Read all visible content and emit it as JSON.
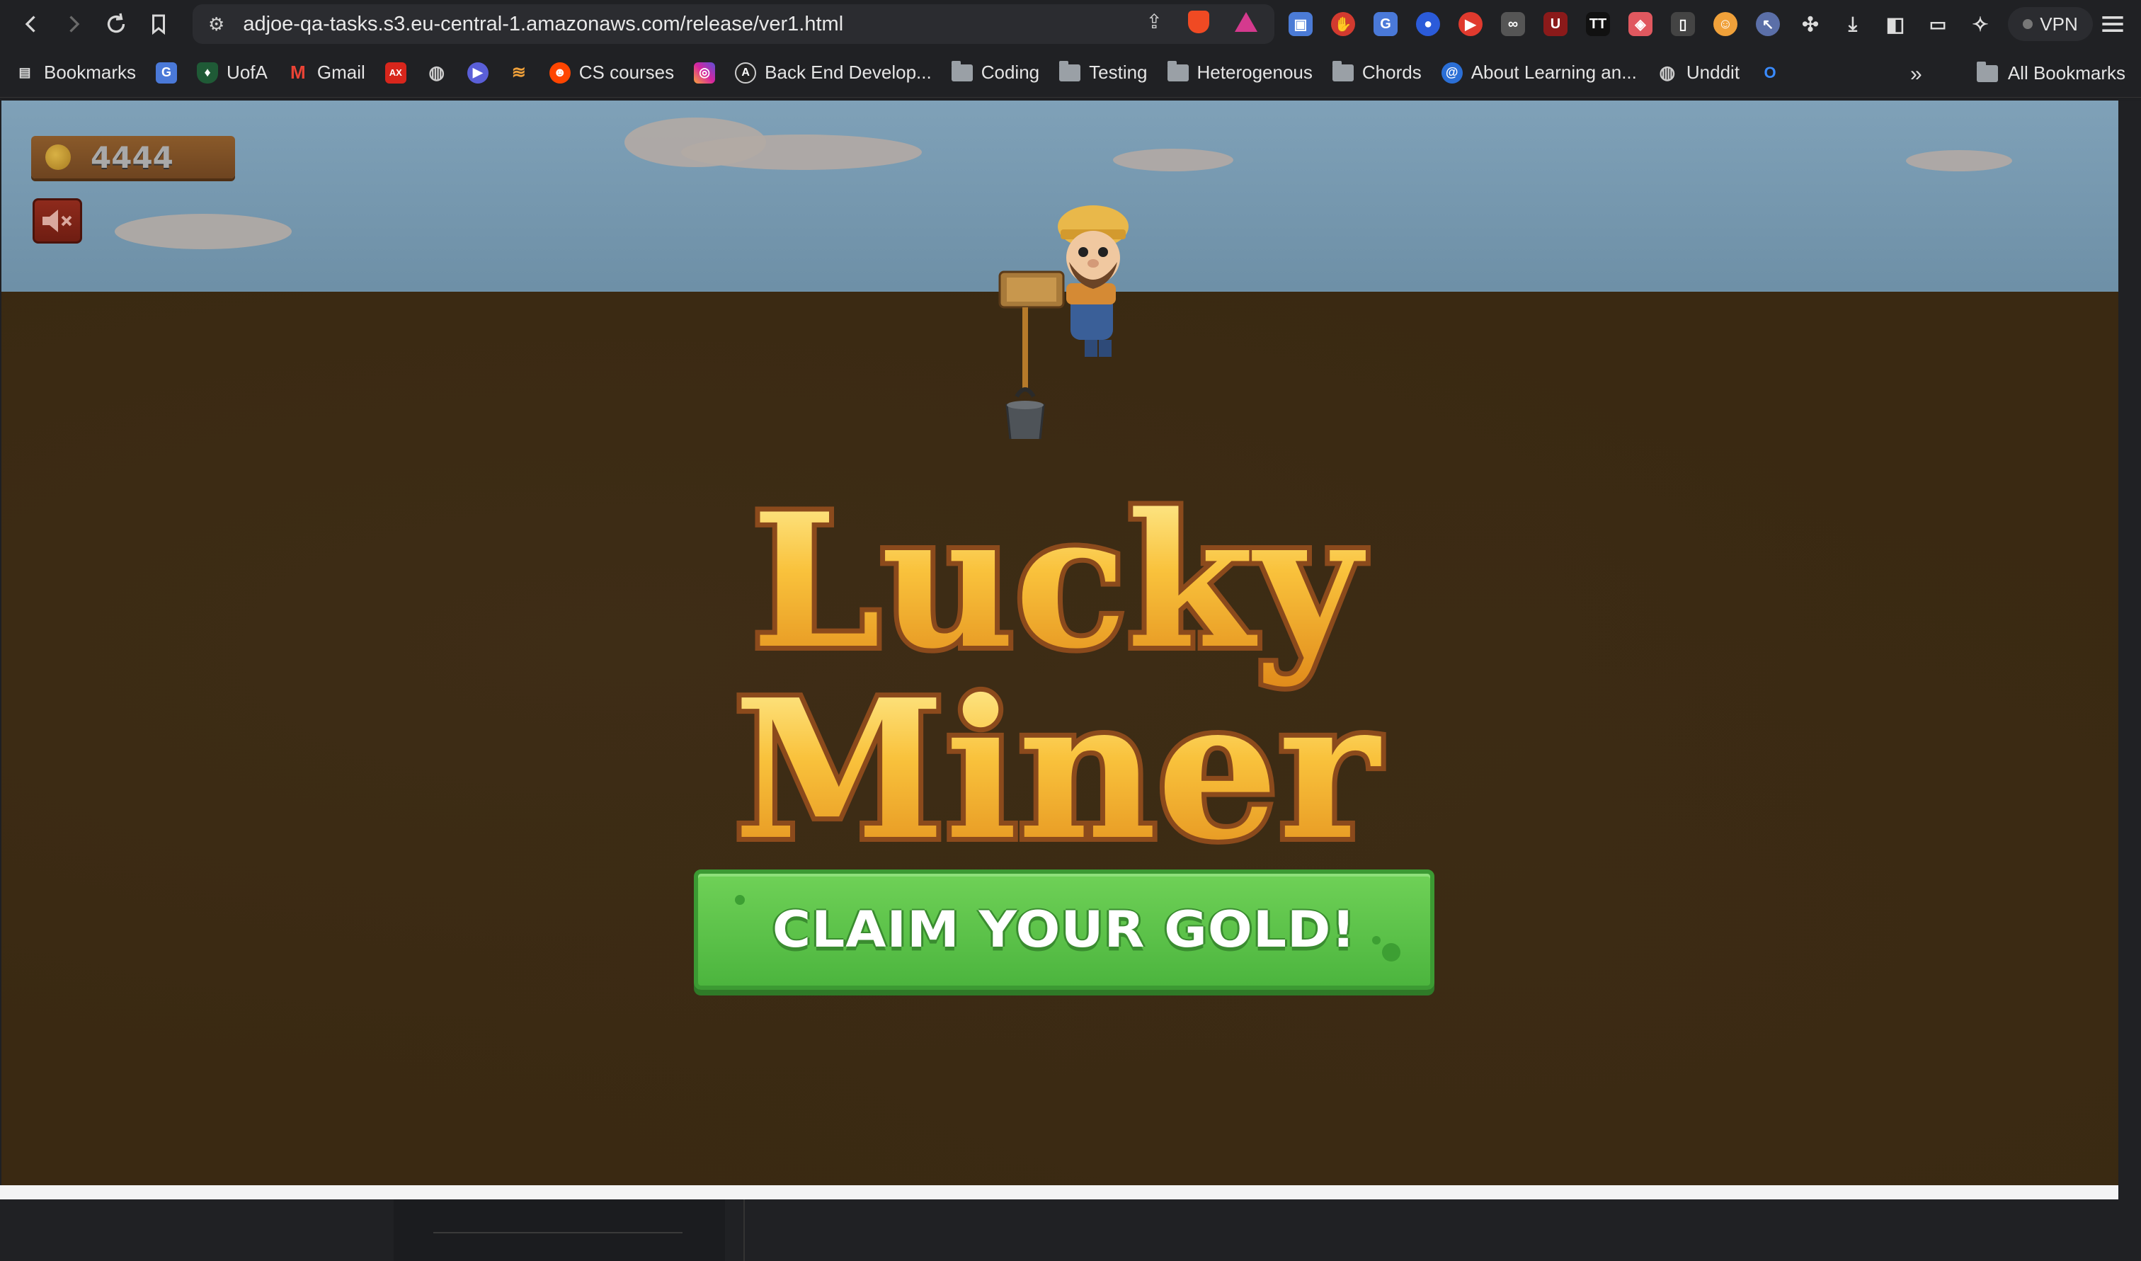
{
  "browser": {
    "url": "adjoe-qa-tasks.s3.eu-central-1.amazonaws.com/release/ver1.html",
    "vpn_label": "VPN",
    "bookmarks": [
      {
        "label": "Bookmarks",
        "icon": "bookmark-book-icon"
      },
      {
        "label": "",
        "icon": "translate-icon"
      },
      {
        "label": "UofA",
        "icon": "shield-icon"
      },
      {
        "label": "Gmail",
        "icon": "gmail-icon"
      },
      {
        "label": "",
        "icon": "brand-icon"
      },
      {
        "label": "",
        "icon": "globe-icon"
      },
      {
        "label": "",
        "icon": "play-icon"
      },
      {
        "label": "",
        "icon": "stack-icon"
      },
      {
        "label": "CS courses",
        "icon": "reddit-icon"
      },
      {
        "label": "",
        "icon": "instagram-icon"
      },
      {
        "label": "Back End Develop...",
        "icon": "a-logo-icon"
      },
      {
        "label": "Coding",
        "icon": "folder-icon"
      },
      {
        "label": "Testing",
        "icon": "folder-icon"
      },
      {
        "label": "Heterogenous",
        "icon": "folder-icon"
      },
      {
        "label": "Chords",
        "icon": "folder-icon"
      },
      {
        "label": "About Learning an...",
        "icon": "swirl-icon"
      },
      {
        "label": "Unddit",
        "icon": "globe-icon"
      },
      {
        "label": "",
        "icon": "o-logo-icon"
      }
    ],
    "all_bookmarks_label": "All Bookmarks"
  },
  "game": {
    "score": "4444",
    "title_line1": "Lucky",
    "title_line2": "Miner",
    "claim_button_label": "CLAIM YOUR GOLD!",
    "colors": {
      "sky": "#7fa1b8",
      "ground": "#3a2912",
      "button_green": "#5cc24a",
      "title_gold": "#f5b62e",
      "title_outline": "#8b4a1c"
    }
  }
}
